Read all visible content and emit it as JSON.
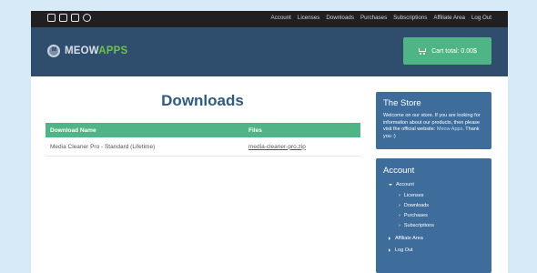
{
  "topbar": {
    "social_icons": [
      "twitter-icon",
      "facebook-icon",
      "instagram-icon",
      "wordpress-icon"
    ],
    "nav": [
      "Account",
      "Licenses",
      "Downloads",
      "Purchases",
      "Subscriptions",
      "Affiliate Area",
      "Log Out"
    ]
  },
  "header": {
    "logo_part1": "MEOW",
    "logo_part2": "APPS",
    "cart_label": "Cart total: 0.00$"
  },
  "main": {
    "title": "Downloads",
    "table": {
      "columns": [
        "Download Name",
        "Files"
      ],
      "rows": [
        {
          "name": "Media Cleaner Pro - Standard (Lifetime)",
          "file": "media-cleaner-pro.zip"
        }
      ]
    }
  },
  "sidebar": {
    "store": {
      "title": "The Store",
      "text": "Welcome on our store. If you are looking for information about our products, then please visit the official website: ",
      "link": "Meow Apps",
      "suffix": ". Thank you :)"
    },
    "account": {
      "title": "Account",
      "root": "Account",
      "children": [
        "Licenses",
        "Downloads",
        "Purchases",
        "Subscriptions"
      ],
      "others": [
        "Affiliate Area",
        "Log Out"
      ]
    }
  },
  "colors": {
    "background": "#d6eaf8",
    "topbar": "#202020",
    "header": "#2f4d6d",
    "accent_green": "#4fb586",
    "title_blue": "#2e5a86",
    "sidebar_blue": "#3e6d9c"
  }
}
